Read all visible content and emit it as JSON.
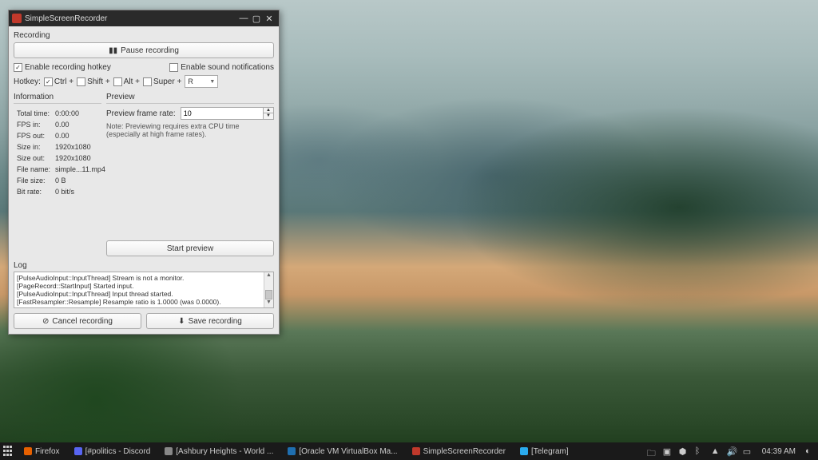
{
  "window": {
    "title": "SimpleScreenRecorder",
    "recording_label": "Recording",
    "pause_label": "Pause recording",
    "enable_hotkey_label": "Enable recording hotkey",
    "enable_sound_label": "Enable sound notifications",
    "hotkey_label": "Hotkey:",
    "ctrl_label": "Ctrl +",
    "shift_label": "Shift +",
    "alt_label": "Alt +",
    "super_label": "Super +",
    "hotkey_key": "R",
    "info_title": "Information",
    "preview_title": "Preview",
    "info": {
      "total_time_label": "Total time:",
      "total_time": "0:00:00",
      "fps_in_label": "FPS in:",
      "fps_in": "0.00",
      "fps_out_label": "FPS out:",
      "fps_out": "0.00",
      "size_in_label": "Size in:",
      "size_in": "1920x1080",
      "size_out_label": "Size out:",
      "size_out": "1920x1080",
      "file_name_label": "File name:",
      "file_name": "simple...11.mp4",
      "file_size_label": "File size:",
      "file_size": "0 B",
      "bit_rate_label": "Bit rate:",
      "bit_rate": "0 bit/s"
    },
    "preview_rate_label": "Preview frame rate:",
    "preview_rate_value": "10",
    "preview_note": "Note: Previewing requires extra CPU time (especially at high frame rates).",
    "start_preview_label": "Start preview",
    "log_label": "Log",
    "log_lines": [
      "[PulseAudioInput::InputThread] Stream is not a monitor.",
      "[PageRecord::StartInput] Started input.",
      "[PulseAudioInput::InputThread] Input thread started.",
      "[FastResampler::Resample] Resample ratio is 1.0000 (was 0.0000)."
    ],
    "cancel_label": "Cancel recording",
    "save_label": "Save recording"
  },
  "taskbar": {
    "items": [
      {
        "label": "Firefox",
        "color": "#e66000"
      },
      {
        "label": "[#politics - Discord",
        "color": "#5865F2"
      },
      {
        "label": "[Ashbury Heights - World ...",
        "color": "#888"
      },
      {
        "label": "[Oracle VM VirtualBox Ma...",
        "color": "#1f6fb0"
      },
      {
        "label": "SimpleScreenRecorder",
        "color": "#c0392b"
      },
      {
        "label": "[Telegram]",
        "color": "#2aabee"
      }
    ],
    "clock": "04:39 AM"
  }
}
